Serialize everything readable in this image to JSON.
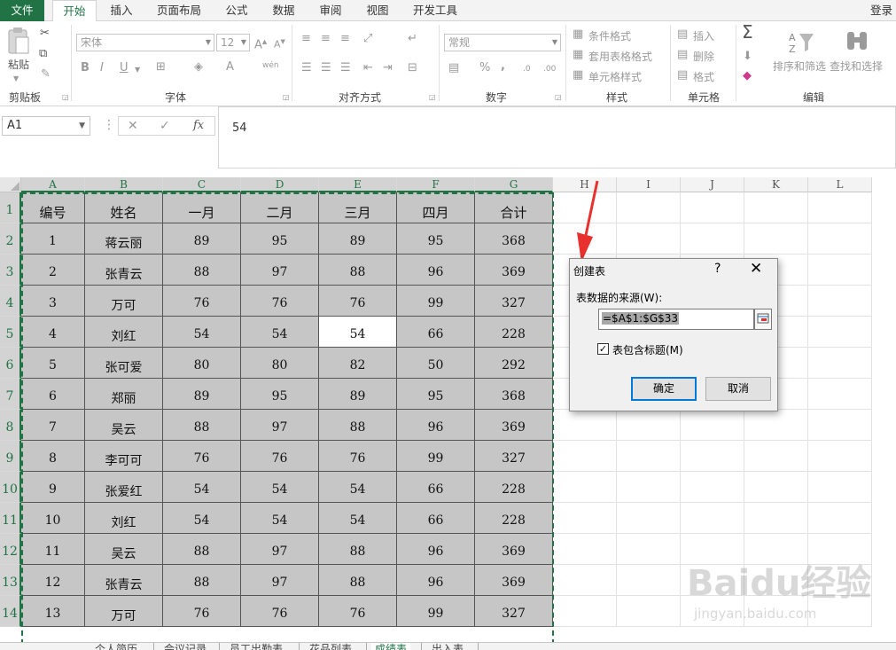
{
  "ribbon_tabs": [
    "文件",
    "开始",
    "插入",
    "页面布局",
    "公式",
    "数据",
    "审阅",
    "视图",
    "开发工具"
  ],
  "login_label": "登录",
  "ribbon": {
    "clipboard": {
      "paste_label": "粘贴",
      "group_label": "剪贴板"
    },
    "font": {
      "font_name": "宋体",
      "font_size": "12",
      "bold": "B",
      "italic": "I",
      "underline": "U",
      "font_color_letter": "A",
      "phonetic": "wén",
      "group_label": "字体"
    },
    "alignment": {
      "group_label": "对齐方式"
    },
    "number": {
      "format": "常规",
      "percent": "%",
      "comma": ",",
      "group_label": "数字"
    },
    "styles": {
      "conditional": "条件格式",
      "table_format": "套用表格格式",
      "cell_styles": "单元格样式",
      "group_label": "样式"
    },
    "cells": {
      "insert": "插入",
      "delete": "删除",
      "format": "格式",
      "group_label": "单元格"
    },
    "editing": {
      "sort_filter": "排序和筛选",
      "find_select": "查找和选择",
      "group_label": "编辑"
    }
  },
  "formula_bar": {
    "name_box": "A1",
    "fx": "fx",
    "content": "54"
  },
  "columns": [
    "A",
    "B",
    "C",
    "D",
    "E",
    "F",
    "G",
    "H",
    "I",
    "J",
    "K",
    "L"
  ],
  "rows": [
    "1",
    "2",
    "3",
    "4",
    "5",
    "6",
    "7",
    "8",
    "9",
    "10",
    "11",
    "12",
    "13",
    "14"
  ],
  "table": {
    "headers": [
      "编号",
      "姓名",
      "一月",
      "二月",
      "三月",
      "四月",
      "合计"
    ],
    "records": [
      [
        "1",
        "蒋云丽",
        "89",
        "95",
        "89",
        "95",
        "368"
      ],
      [
        "2",
        "张青云",
        "88",
        "97",
        "88",
        "96",
        "369"
      ],
      [
        "3",
        "万可",
        "76",
        "76",
        "76",
        "99",
        "327"
      ],
      [
        "4",
        "刘红",
        "54",
        "54",
        "54",
        "66",
        "228"
      ],
      [
        "5",
        "张可爱",
        "80",
        "80",
        "82",
        "50",
        "292"
      ],
      [
        "6",
        "郑丽",
        "89",
        "95",
        "89",
        "95",
        "368"
      ],
      [
        "7",
        "吴云",
        "88",
        "97",
        "88",
        "96",
        "369"
      ],
      [
        "8",
        "李可可",
        "76",
        "76",
        "76",
        "99",
        "327"
      ],
      [
        "9",
        "张爱红",
        "54",
        "54",
        "54",
        "66",
        "228"
      ],
      [
        "10",
        "刘红",
        "54",
        "54",
        "54",
        "66",
        "228"
      ],
      [
        "11",
        "吴云",
        "88",
        "97",
        "88",
        "96",
        "369"
      ],
      [
        "12",
        "张青云",
        "88",
        "97",
        "88",
        "96",
        "369"
      ],
      [
        "13",
        "万可",
        "76",
        "76",
        "76",
        "99",
        "327"
      ]
    ]
  },
  "sheet_tabs": [
    "个人简历",
    "会议记录",
    "员工出勤表",
    "花品列表",
    "成绩表",
    "出入表"
  ],
  "active_sheet": "成绩表",
  "dialog": {
    "title": "创建表",
    "help": "?",
    "close": "✕",
    "source_label": "表数据的来源(W):",
    "range": "=$A$1:$G$33",
    "has_headers_label": "表包含标题(M)",
    "has_headers_checked": "☑",
    "ok_label": "确定",
    "cancel_label": "取消"
  },
  "watermark": {
    "main": "Baidu经验",
    "sub": "jingyan.baidu.com"
  },
  "colors": {
    "excel_green": "#217346",
    "selection_gray": "#c6c6c6",
    "arrow_red": "#e8312f",
    "dialog_bg": "#f0f0f0",
    "accent_blue": "#0078d7"
  }
}
